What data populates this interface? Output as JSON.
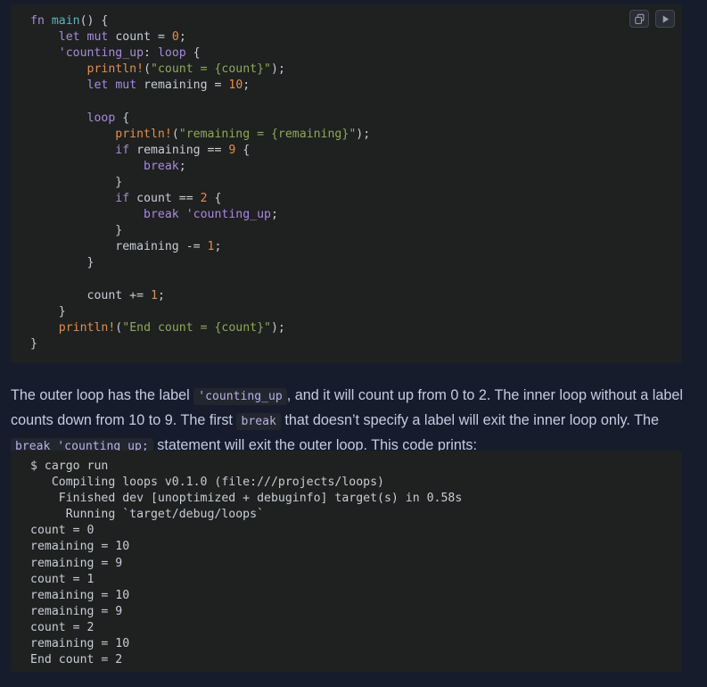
{
  "code_block": {
    "language": "rust",
    "toolbar": {
      "copy_label": "copy-icon",
      "run_label": "play-icon"
    },
    "lines": [
      [
        {
          "t": "kw",
          "v": "fn"
        },
        {
          "t": "punc",
          "v": " "
        },
        {
          "t": "fnnm",
          "v": "main"
        },
        {
          "t": "punc",
          "v": "() {"
        }
      ],
      [
        {
          "t": "punc",
          "v": "    "
        },
        {
          "t": "kw",
          "v": "let"
        },
        {
          "t": "punc",
          "v": " "
        },
        {
          "t": "kw",
          "v": "mut"
        },
        {
          "t": "punc",
          "v": " "
        },
        {
          "t": "id",
          "v": "count"
        },
        {
          "t": "punc",
          "v": " = "
        },
        {
          "t": "num",
          "v": "0"
        },
        {
          "t": "punc",
          "v": ";"
        }
      ],
      [
        {
          "t": "punc",
          "v": "    "
        },
        {
          "t": "lbl",
          "v": "'counting_up"
        },
        {
          "t": "punc",
          "v": ": "
        },
        {
          "t": "kw",
          "v": "loop"
        },
        {
          "t": "punc",
          "v": " {"
        }
      ],
      [
        {
          "t": "punc",
          "v": "        "
        },
        {
          "t": "macro",
          "v": "println!"
        },
        {
          "t": "punc",
          "v": "("
        },
        {
          "t": "str",
          "v": "\"count = {count}\""
        },
        {
          "t": "punc",
          "v": ");"
        }
      ],
      [
        {
          "t": "punc",
          "v": "        "
        },
        {
          "t": "kw",
          "v": "let"
        },
        {
          "t": "punc",
          "v": " "
        },
        {
          "t": "kw",
          "v": "mut"
        },
        {
          "t": "punc",
          "v": " "
        },
        {
          "t": "id",
          "v": "remaining"
        },
        {
          "t": "punc",
          "v": " = "
        },
        {
          "t": "num",
          "v": "10"
        },
        {
          "t": "punc",
          "v": ";"
        }
      ],
      [],
      [
        {
          "t": "punc",
          "v": "        "
        },
        {
          "t": "kw",
          "v": "loop"
        },
        {
          "t": "punc",
          "v": " {"
        }
      ],
      [
        {
          "t": "punc",
          "v": "            "
        },
        {
          "t": "macro",
          "v": "println!"
        },
        {
          "t": "punc",
          "v": "("
        },
        {
          "t": "str",
          "v": "\"remaining = {remaining}\""
        },
        {
          "t": "punc",
          "v": ");"
        }
      ],
      [
        {
          "t": "punc",
          "v": "            "
        },
        {
          "t": "kw",
          "v": "if"
        },
        {
          "t": "punc",
          "v": " "
        },
        {
          "t": "id",
          "v": "remaining"
        },
        {
          "t": "punc",
          "v": " == "
        },
        {
          "t": "num",
          "v": "9"
        },
        {
          "t": "punc",
          "v": " {"
        }
      ],
      [
        {
          "t": "punc",
          "v": "                "
        },
        {
          "t": "kw",
          "v": "break"
        },
        {
          "t": "punc",
          "v": ";"
        }
      ],
      [
        {
          "t": "punc",
          "v": "            }"
        }
      ],
      [
        {
          "t": "punc",
          "v": "            "
        },
        {
          "t": "kw",
          "v": "if"
        },
        {
          "t": "punc",
          "v": " "
        },
        {
          "t": "id",
          "v": "count"
        },
        {
          "t": "punc",
          "v": " == "
        },
        {
          "t": "num",
          "v": "2"
        },
        {
          "t": "punc",
          "v": " {"
        }
      ],
      [
        {
          "t": "punc",
          "v": "                "
        },
        {
          "t": "kw",
          "v": "break"
        },
        {
          "t": "punc",
          "v": " "
        },
        {
          "t": "lbl",
          "v": "'counting_up"
        },
        {
          "t": "punc",
          "v": ";"
        }
      ],
      [
        {
          "t": "punc",
          "v": "            }"
        }
      ],
      [
        {
          "t": "punc",
          "v": "            "
        },
        {
          "t": "id",
          "v": "remaining"
        },
        {
          "t": "punc",
          "v": " -= "
        },
        {
          "t": "num",
          "v": "1"
        },
        {
          "t": "punc",
          "v": ";"
        }
      ],
      [
        {
          "t": "punc",
          "v": "        }"
        }
      ],
      [],
      [
        {
          "t": "punc",
          "v": "        "
        },
        {
          "t": "id",
          "v": "count"
        },
        {
          "t": "punc",
          "v": " += "
        },
        {
          "t": "num",
          "v": "1"
        },
        {
          "t": "punc",
          "v": ";"
        }
      ],
      [
        {
          "t": "punc",
          "v": "    }"
        }
      ],
      [
        {
          "t": "punc",
          "v": "    "
        },
        {
          "t": "macro",
          "v": "println!"
        },
        {
          "t": "punc",
          "v": "("
        },
        {
          "t": "str",
          "v": "\"End count = {count}\""
        },
        {
          "t": "punc",
          "v": ");"
        }
      ],
      [
        {
          "t": "punc",
          "v": "}"
        }
      ]
    ]
  },
  "prose": {
    "segments": [
      {
        "type": "text",
        "v": "The outer loop has the label "
      },
      {
        "type": "code",
        "v": "'counting_up"
      },
      {
        "type": "text",
        "v": ", and it will count up from 0 to 2. The inner loop without a label counts down from 10 to 9. The first "
      },
      {
        "type": "code",
        "v": "break"
      },
      {
        "type": "text",
        "v": " that doesn’t specify a label will exit the inner loop only. The "
      },
      {
        "type": "code",
        "v": "break 'counting_up;"
      },
      {
        "type": "text",
        "v": " statement will exit the outer loop. This code prints:"
      }
    ]
  },
  "terminal": {
    "lines": [
      "$ cargo run",
      "   Compiling loops v0.1.0 (file:///projects/loops)",
      "    Finished dev [unoptimized + debuginfo] target(s) in 0.58s",
      "     Running `target/debug/loops`",
      "count = 0",
      "remaining = 10",
      "remaining = 9",
      "count = 1",
      "remaining = 10",
      "remaining = 9",
      "count = 2",
      "remaining = 10",
      "End count = 2"
    ]
  },
  "colors": {
    "page_background": "#171c2c",
    "block_background": "#1f2020",
    "prose_text": "#c3cce0",
    "code_text": "#c8cdd4",
    "keyword": "#a78bde",
    "macro": "#e08f4f",
    "string": "#8fa85a",
    "number": "#e08f4f",
    "function_name": "#57b6c2",
    "inline_code_bg": "#22262f",
    "inline_code_fg": "#b9b2e4"
  }
}
